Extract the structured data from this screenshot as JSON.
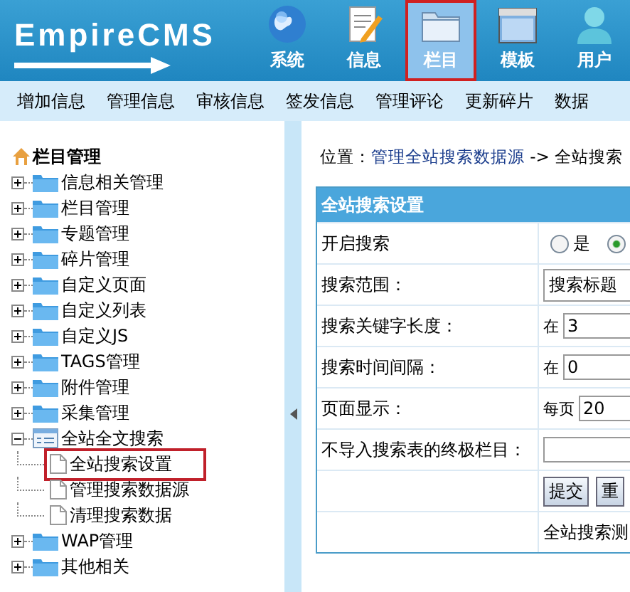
{
  "logo": {
    "text": "EmpireCMS"
  },
  "top_nav": [
    {
      "label": "系统",
      "selected": false
    },
    {
      "label": "信息",
      "selected": false
    },
    {
      "label": "栏目",
      "selected": true
    },
    {
      "label": "模板",
      "selected": false
    },
    {
      "label": "用户",
      "selected": false
    }
  ],
  "sub_nav": [
    "增加信息",
    "管理信息",
    "审核信息",
    "签发信息",
    "管理评论",
    "更新碎片",
    "数据"
  ],
  "tree": {
    "title": "栏目管理",
    "items": [
      {
        "label": "信息相关管理",
        "expanded": false
      },
      {
        "label": "栏目管理",
        "expanded": false
      },
      {
        "label": "专题管理",
        "expanded": false
      },
      {
        "label": "碎片管理",
        "expanded": false
      },
      {
        "label": "自定义页面",
        "expanded": false
      },
      {
        "label": "自定义列表",
        "expanded": false
      },
      {
        "label": "自定义JS",
        "expanded": false
      },
      {
        "label": "TAGS管理",
        "expanded": false
      },
      {
        "label": "附件管理",
        "expanded": false
      },
      {
        "label": "采集管理",
        "expanded": false
      },
      {
        "label": "全站全文搜索",
        "expanded": true,
        "children": [
          {
            "label": "全站搜索设置",
            "selected": true
          },
          {
            "label": "管理搜索数据源",
            "selected": false
          },
          {
            "label": "清理搜索数据",
            "selected": false
          }
        ]
      },
      {
        "label": "WAP管理",
        "expanded": false
      },
      {
        "label": "其他相关",
        "expanded": false
      }
    ]
  },
  "breadcrumb": {
    "prefix": "位置：",
    "link": "管理全站搜索数据源",
    "suffix": "-> 全站搜索"
  },
  "form": {
    "title": "全站搜索设置",
    "rows": [
      {
        "kind": "radio",
        "label": "开启搜索",
        "options": [
          {
            "label": "是",
            "selected": false
          },
          {
            "selected": true
          }
        ]
      },
      {
        "kind": "select",
        "label": "搜索范围：",
        "value": "搜索标题"
      },
      {
        "kind": "input",
        "label": "搜索关键字长度：",
        "prefix": "在",
        "value": "3"
      },
      {
        "kind": "input",
        "label": "搜索时间间隔：",
        "prefix": "在",
        "value": "0"
      },
      {
        "kind": "input",
        "label": "页面显示：",
        "prefix": "每页",
        "value": "20"
      },
      {
        "kind": "input",
        "label": "不导入搜索表的终极栏目："
      },
      {
        "kind": "buttons",
        "buttons": [
          "提交",
          "重"
        ]
      },
      {
        "kind": "text",
        "text": "全站搜索测"
      }
    ]
  }
}
